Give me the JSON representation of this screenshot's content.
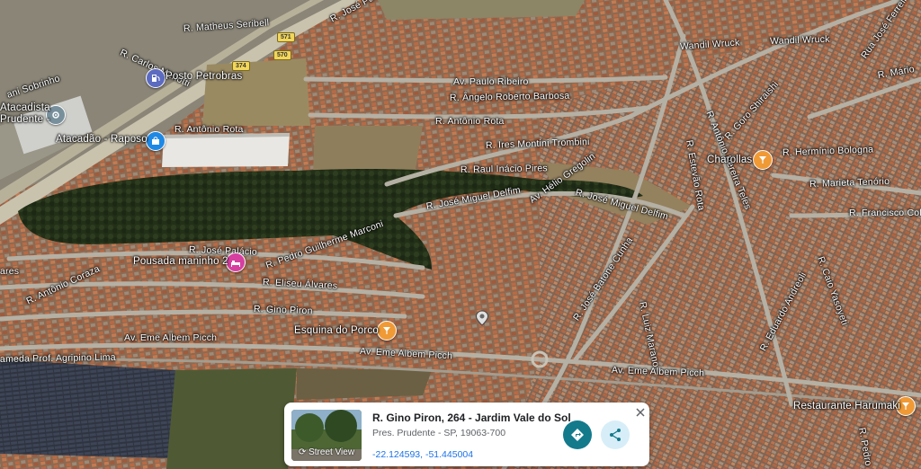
{
  "streets": [
    {
      "id": "r-matheus-seribelli",
      "text": "R. Matheus Seribell"
    },
    {
      "id": "r-jose-pa",
      "text": "R. José Pa"
    },
    {
      "id": "r-carlos-menotti",
      "text": "R. Carlos Menotti"
    },
    {
      "id": "ani-sobrinho",
      "text": "ani Sobrinho"
    },
    {
      "id": "r-jose-ferreira",
      "text": "Rua José Ferreira"
    },
    {
      "id": "wandil-wruck-1",
      "text": "Wandil Wruck"
    },
    {
      "id": "wandil-wruck-2",
      "text": "Wandil Wruck"
    },
    {
      "id": "r-mario",
      "text": "R. Mário"
    },
    {
      "id": "av-paulo-ribeiro",
      "text": "Av. Paulo Ribeiro"
    },
    {
      "id": "r-angelo-roberto-barbosa",
      "text": "R. Ângelo Roberto Barbosa"
    },
    {
      "id": "r-antonio-rota-1",
      "text": "R. Antônio Rota"
    },
    {
      "id": "r-antonio-rota-2",
      "text": "R. Antônio Rota"
    },
    {
      "id": "r-antonio-pereira-teles",
      "text": "R. Antônio Pereira Teles"
    },
    {
      "id": "r-goro-shiraishi",
      "text": "R. Goro Shiraishi"
    },
    {
      "id": "r-ires-montini-trombini",
      "text": "R. Ires Montini Trombini"
    },
    {
      "id": "r-estevao-rota",
      "text": "R. Estevão Rota"
    },
    {
      "id": "r-herminio-bologna",
      "text": "R. Hermínio Bologna"
    },
    {
      "id": "r-raul-inacio-pires",
      "text": "R. Raul Inácio Pires"
    },
    {
      "id": "r-marieta-tenorio",
      "text": "R. Marieta Tenório"
    },
    {
      "id": "av-helio-gregolin",
      "text": "Av. Hélio Gregolin"
    },
    {
      "id": "r-jose-miguel-delfim-1",
      "text": "R. José Miguel Delfim"
    },
    {
      "id": "r-jose-miguel-delfim-2",
      "text": "R. José Miguel Delfim"
    },
    {
      "id": "r-francisco-col",
      "text": "R. Francisco Col"
    },
    {
      "id": "r-jose-palacio",
      "text": "R. José Palácio"
    },
    {
      "id": "r-pedro-guilherme-marconi",
      "text": "R. Pedro Guilherme Marconi"
    },
    {
      "id": "r-jose-batone-cunha",
      "text": "R. José Batone Cunha"
    },
    {
      "id": "r-luiz-marano",
      "text": "R. Luiz Marano"
    },
    {
      "id": "r-caio-yasoyeti",
      "text": "R. Caio Yasoyeti"
    },
    {
      "id": "ares",
      "text": "ares"
    },
    {
      "id": "r-antonio-coraza",
      "text": "R. Antônio Coraza"
    },
    {
      "id": "r-eliseu-alvares",
      "text": "R. Eliseu Álvares"
    },
    {
      "id": "r-eduardo-andreoli",
      "text": "R. Eduardo Andreoli"
    },
    {
      "id": "r-gino-piron",
      "text": "R. Gino Piron"
    },
    {
      "id": "av-eme-albem-picch-1",
      "text": "Av. Eme Albem Picch"
    },
    {
      "id": "av-eme-albem-picch-2",
      "text": "Av. Eme Albem Picch"
    },
    {
      "id": "av-eme-albem-picch-3",
      "text": "Av. Eme Albem Picch"
    },
    {
      "id": "ameda-prof-agripino-lima",
      "text": "ameda Prof. Agripino Lima"
    },
    {
      "id": "r-pedro",
      "text": "R. Pedro"
    }
  ],
  "shields": [
    {
      "id": "shield-571",
      "text": "571"
    },
    {
      "id": "shield-374",
      "text": "374"
    },
    {
      "id": "shield-570",
      "text": "570"
    }
  ],
  "places": [
    {
      "id": "posto-petrobras",
      "text": "Posto Petrobras",
      "color": "#5c6bc0",
      "icon": "fuel-icon"
    },
    {
      "id": "atacadista-prudente",
      "text": "Atacadista\nPrudente -",
      "color": "#78909c",
      "icon": "location-icon"
    },
    {
      "id": "atacadao-raposo",
      "text": "Atacadão - Raposo",
      "color": "#1e88e5",
      "icon": "shopping-bag-icon"
    },
    {
      "id": "charollas",
      "text": "Charollas",
      "color": "#f09a36",
      "icon": "restaurant-icon"
    },
    {
      "id": "pousada-maninho-2",
      "text": "Pousada maninho 2",
      "color": "#d63fa0",
      "icon": "bed-icon"
    },
    {
      "id": "esquina-do-porco",
      "text": "Esquina do Porco",
      "color": "#f09a36",
      "icon": "restaurant-icon"
    },
    {
      "id": "restaurante-harumaki",
      "text": "Restaurante Harumaki",
      "color": "#f09a36",
      "icon": "restaurant-icon"
    }
  ],
  "card": {
    "address": "R. Gino Piron, 264 - Jardim Vale do Sol",
    "locality": "Pres. Prudente - SP, 19063-700",
    "coordinates": "-22.124593, -51.445004",
    "street_view_label": "Street View",
    "accent": "#137a8c"
  }
}
